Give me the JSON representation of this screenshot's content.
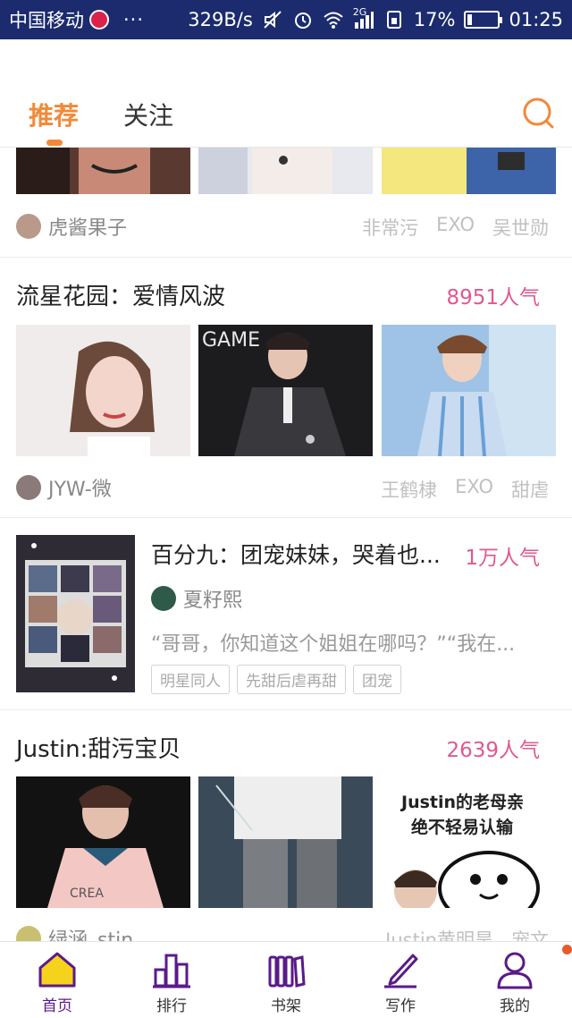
{
  "status_bar": {
    "carrier": "中国移动",
    "more": "···",
    "speed": "329B/s",
    "network": "2G",
    "battery_percent": 17,
    "battery_label": "17%",
    "time": "01:25"
  },
  "header": {
    "tabs": [
      {
        "label": "推荐",
        "active": true
      },
      {
        "label": "关注",
        "active": false
      }
    ],
    "search_icon": "search-icon",
    "accent_color": "#f2893a"
  },
  "feed": {
    "post0": {
      "author": "虎酱果子",
      "tags": [
        "非常污",
        "EXO",
        "吴世勋"
      ]
    },
    "post1": {
      "title": "流星花园：爱情风波",
      "popularity": "8951人气",
      "author": "JYW-微",
      "tags": [
        "王鹤棣",
        "EXO",
        "甜虐"
      ]
    },
    "post2": {
      "title": "百分九：团宠妹妹，哭着也...",
      "popularity": "1万人气",
      "author": "夏籽熙",
      "excerpt": "“哥哥，你知道这个姐姐在哪吗？”“我在...",
      "tags": [
        "明星同人",
        "先甜后虐再甜",
        "团宠"
      ]
    },
    "post3": {
      "title": "Justin:甜污宝贝",
      "popularity": "2639人气",
      "image_caption_line1": "Justin的老母亲",
      "image_caption_line2": "绝不轻易认输",
      "author": "绿涵_stin",
      "tags": [
        "Justin黄明昊",
        "宠文"
      ]
    }
  },
  "bottom_nav": {
    "items": [
      {
        "label": "首页",
        "icon": "home-icon",
        "active": true
      },
      {
        "label": "排行",
        "icon": "ranking-icon",
        "active": false
      },
      {
        "label": "书架",
        "icon": "bookshelf-icon",
        "active": false
      },
      {
        "label": "写作",
        "icon": "write-icon",
        "active": false
      },
      {
        "label": "我的",
        "icon": "profile-icon",
        "active": false
      }
    ],
    "active_color": "#5a1a8a",
    "notification_dot_color": "#e85a2a"
  }
}
